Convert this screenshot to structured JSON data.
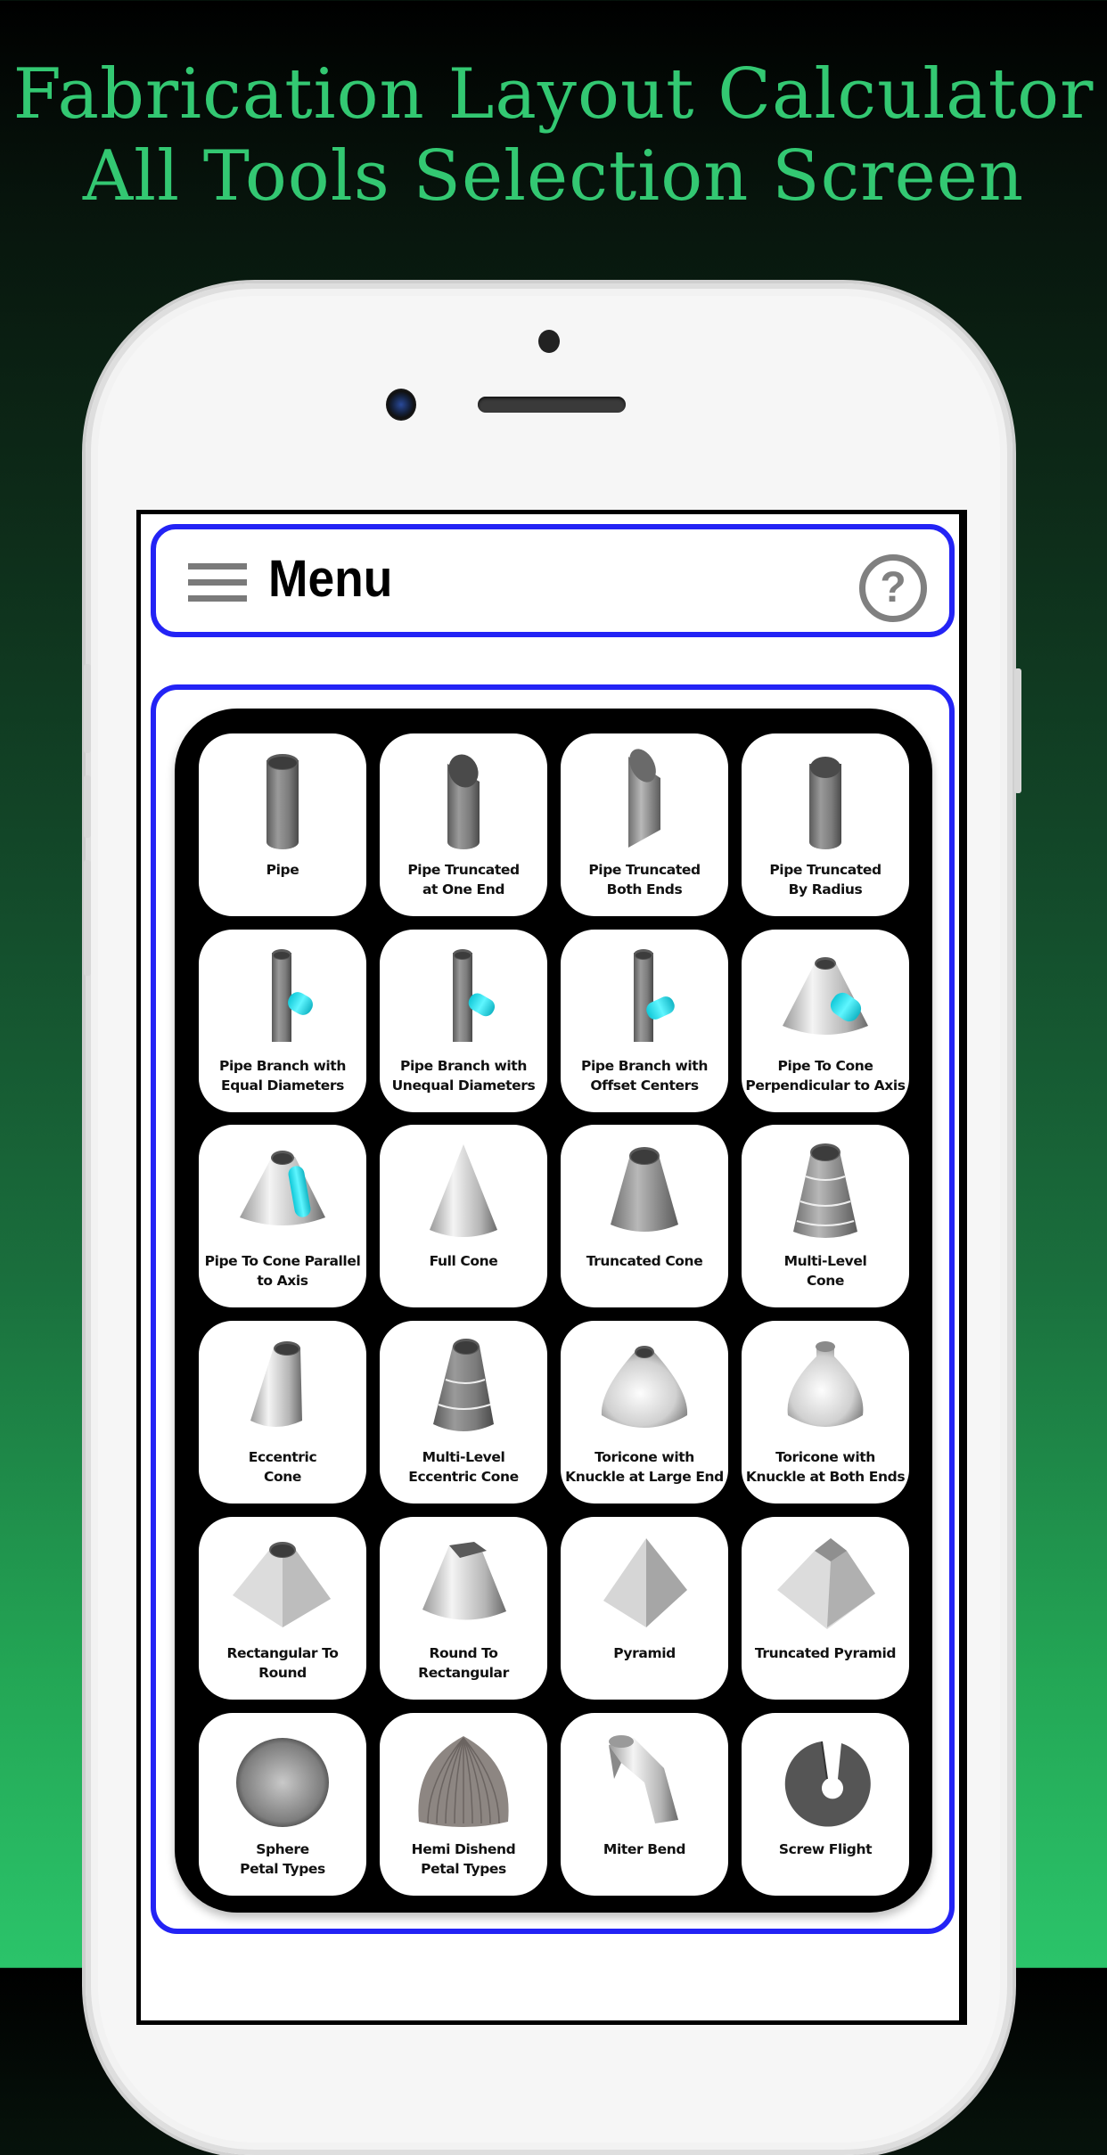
{
  "promo": {
    "line1": "Fabrication Layout Calculator",
    "line2": "All Tools Selection Screen",
    "text_color": "#33c872"
  },
  "appbar": {
    "menu_icon": "hamburger-icon",
    "title": "Menu",
    "help_icon": "help-circle-icon",
    "help_glyph": "?",
    "border_color": "#2323f5"
  },
  "tools": [
    {
      "label": "Pipe",
      "icon": "pipe"
    },
    {
      "label": "Pipe Truncated\nat One End",
      "icon": "pipe-truncated-one"
    },
    {
      "label": "Pipe Truncated\nBoth Ends",
      "icon": "pipe-truncated-both"
    },
    {
      "label": "Pipe Truncated\nBy Radius",
      "icon": "pipe-truncated-radius"
    },
    {
      "label": "Pipe Branch with\nEqual Diameters",
      "icon": "branch-equal"
    },
    {
      "label": "Pipe Branch with\nUnequal Diameters",
      "icon": "branch-unequal"
    },
    {
      "label": "Pipe Branch with\nOffset Centers",
      "icon": "branch-offset"
    },
    {
      "label": "Pipe To Cone\nPerpendicular to Axis",
      "icon": "pipe-cone-perp"
    },
    {
      "label": "Pipe To Cone Parallel\nto Axis",
      "icon": "pipe-cone-parallel"
    },
    {
      "label": "Full Cone",
      "icon": "full-cone"
    },
    {
      "label": "Truncated Cone",
      "icon": "truncated-cone"
    },
    {
      "label": "Multi-Level\nCone",
      "icon": "multi-level-cone"
    },
    {
      "label": "Eccentric\nCone",
      "icon": "eccentric-cone"
    },
    {
      "label": "Multi-Level\nEccentric Cone",
      "icon": "multi-level-eccentric-cone"
    },
    {
      "label": "Toricone with\nKnuckle at Large End",
      "icon": "toricone-large"
    },
    {
      "label": "Toricone with\nKnuckle at Both Ends",
      "icon": "toricone-both"
    },
    {
      "label": "Rectangular To\nRound",
      "icon": "rect-to-round"
    },
    {
      "label": "Round To\nRectangular",
      "icon": "round-to-rect"
    },
    {
      "label": "Pyramid",
      "icon": "pyramid"
    },
    {
      "label": "Truncated Pyramid",
      "icon": "truncated-pyramid"
    },
    {
      "label": "Sphere\nPetal Types",
      "icon": "sphere"
    },
    {
      "label": "Hemi Dishend\nPetal Types",
      "icon": "hemi-dishend"
    },
    {
      "label": "Miter Bend",
      "icon": "miter-bend"
    },
    {
      "label": "Screw Flight",
      "icon": "screw-flight"
    }
  ]
}
